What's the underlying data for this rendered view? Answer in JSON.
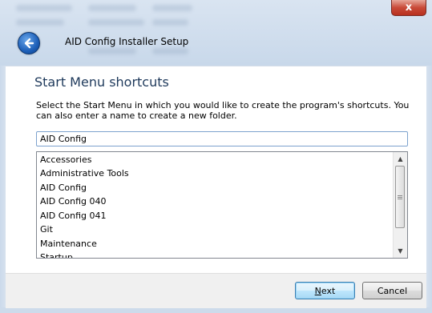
{
  "window": {
    "title": "AID Config Installer Setup",
    "close_glyph": "x"
  },
  "page": {
    "title": "Start Menu shortcuts",
    "description": "Select the Start Menu in which you would like to create the program's shortcuts. You can also enter a name to create a new folder."
  },
  "folder_input": {
    "value": "AID Config"
  },
  "folders": [
    "Accessories",
    "Administrative Tools",
    "AID Config",
    "AID Config 040",
    "AID Config 041",
    "Git",
    "Maintenance",
    "Startup"
  ],
  "buttons": {
    "next": "Next",
    "cancel": "Cancel"
  },
  "icons": {
    "back": "back-arrow-icon",
    "close": "close-icon",
    "scroll_up": "scroll-up-icon",
    "scroll_down": "scroll-down-icon"
  },
  "colors": {
    "title_text": "#1e395b",
    "close_button": "#c94a38",
    "default_button_border": "#3c7fb1"
  }
}
